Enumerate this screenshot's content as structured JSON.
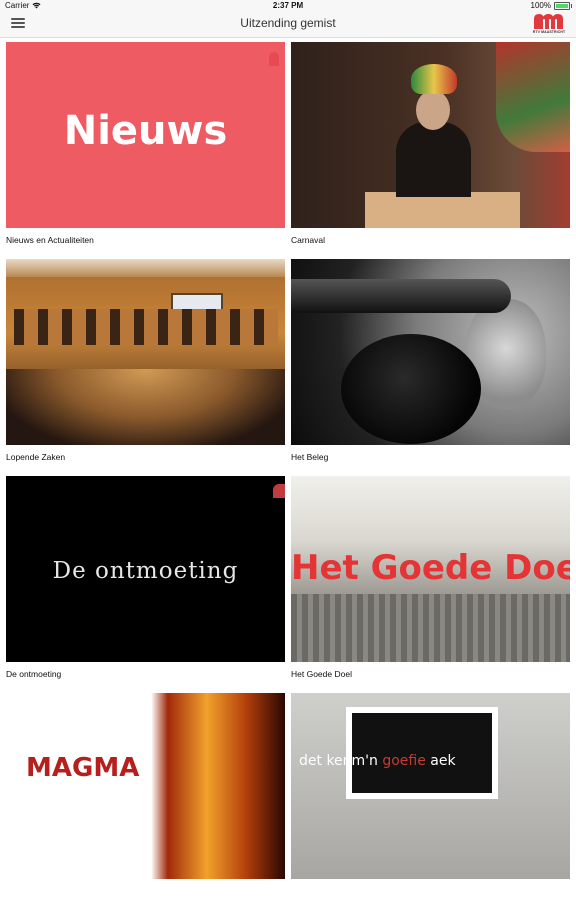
{
  "status_bar": {
    "carrier": "Carrier",
    "time": "2:37 PM",
    "battery_percent": "100%",
    "battery_level": 1.0,
    "wifi_icon": "wifi-icon",
    "battery_icon": "battery-icon"
  },
  "header": {
    "title": "Uitzending gemist",
    "menu_icon": "hamburger-menu-icon",
    "logo_text": "RTV MAASTRICHT",
    "logo_color": "#e0393e"
  },
  "programs": [
    {
      "title": "Nieuws en Actualiteiten",
      "thumb_text": "Nieuws"
    },
    {
      "title": "Carnaval"
    },
    {
      "title": "Lopende Zaken"
    },
    {
      "title": "Het Beleg"
    },
    {
      "title": "De ontmoeting",
      "thumb_text": "De ontmoeting"
    },
    {
      "title": "Het Goede Doel",
      "thumb_text": "Het Goede Doel"
    },
    {
      "title": "",
      "thumb_text": "MAGMA"
    },
    {
      "title": "",
      "thumb_text_a": "det kenm'n ",
      "thumb_text_b": "goefie",
      "thumb_text_c": " aek"
    }
  ],
  "colors": {
    "accent_red": "#ef5b62",
    "battery_green": "#4cd964"
  }
}
